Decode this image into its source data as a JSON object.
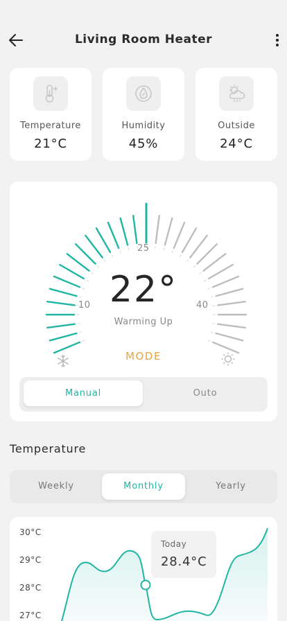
{
  "header": {
    "title": "Living Room Heater",
    "back_icon": "arrow-left-icon",
    "menu_icon": "more-vertical-icon"
  },
  "stats": [
    {
      "label": "Temperature",
      "value": "21°C",
      "icon": "thermometer-icon"
    },
    {
      "label": "Humidity",
      "value": "45%",
      "icon": "humidity-icon"
    },
    {
      "label": "Outside",
      "value": "24°C",
      "icon": "cloud-sun-icon"
    }
  ],
  "thermostat": {
    "temperature": "22°",
    "status": "Warming Up",
    "scale_min": "10",
    "scale_mid": "25",
    "scale_max": "40",
    "mode_label": "MODE",
    "cool_icon": "snowflake-icon",
    "heat_icon": "sun-icon",
    "active_color": "#1fb5a3",
    "modes": [
      "Manual",
      "Outo"
    ],
    "selected_mode": "Manual"
  },
  "temperature_section": {
    "title": "Temperature",
    "periods": [
      "Weekly",
      "Monthly",
      "Yearly"
    ],
    "selected_period": "Monthly"
  },
  "chart": {
    "y_labels": [
      "30°C",
      "29°C",
      "28°C",
      "27°C"
    ],
    "tooltip_label": "Today",
    "tooltip_value": "28.4°C"
  }
}
